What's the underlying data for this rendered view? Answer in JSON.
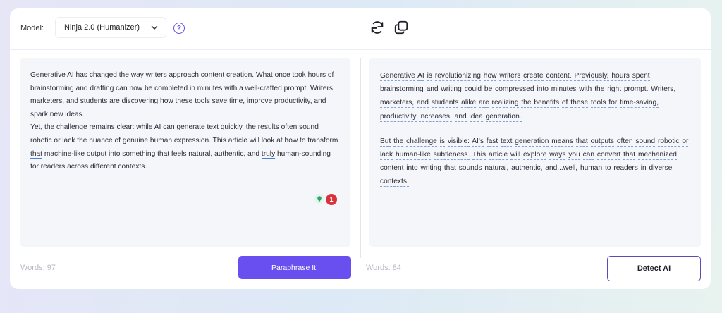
{
  "toolbar": {
    "model_label": "Model:",
    "model_value": "Ninja 2.0 (Humanizer)",
    "help_icon": "question-circle-icon",
    "regenerate_icon": "refresh-icon",
    "copy_icon": "copy-icon"
  },
  "input": {
    "paragraph1": {
      "t1": "Generative AI has changed the way writers approach content creation. What once took hours of brainstorming and drafting can now be completed in minutes with a well-crafted prompt. Writers, marketers, and students are discovering how these tools save time, improve productivity, and spark new ideas."
    },
    "paragraph2": {
      "t1": "Yet, the challenge remains clear: while AI can generate text quickly, the results often sound robotic or lack the nuance of genuine human expression. This article will ",
      "u1": "look at",
      "t2": " how to transform ",
      "u2": "that",
      "t3": " machine-like output into something that feels natural, authentic, and ",
      "u3": "truly",
      "t4": " human-sounding for readers across ",
      "u4": "different",
      "t5": " contexts."
    },
    "suggestion_count": "1",
    "words": "Words: 97"
  },
  "output": {
    "paragraph1": [
      "Generative",
      "AI",
      "is",
      "revolutionizing",
      "how",
      "writers",
      "create",
      "content.",
      "Previously,",
      "hours",
      "spent",
      "brainstorming",
      "and",
      "writing",
      "could",
      "be",
      "compressed",
      "into",
      "minutes",
      "with",
      "the",
      "right",
      "prompt.",
      "Writers,",
      "marketers,",
      "and",
      "students",
      "alike",
      "are",
      "realizing",
      "the",
      "benefits",
      "of",
      "these",
      "tools",
      "for",
      "time-saving,",
      "productivity",
      "increases,",
      "and",
      "idea",
      "generation."
    ],
    "paragraph2": [
      "But",
      "the",
      "challenge",
      "is",
      "visible:",
      "AI's",
      "fast",
      "text",
      "generation",
      "means",
      "that",
      "outputs",
      "often",
      "sound",
      "robotic",
      "or",
      "lack",
      "human-like",
      "subtleness.",
      "This",
      "article",
      "will",
      "explore",
      "ways",
      "you",
      "can",
      "convert",
      "that",
      "mechanized",
      "content",
      "into",
      "writing",
      "that",
      "sounds",
      "natural,",
      "authentic,",
      "and...well,",
      "human",
      "to",
      "readers",
      "in",
      "diverse",
      "contexts."
    ],
    "words": "Words: 84"
  },
  "actions": {
    "paraphrase_label": "Paraphrase It!",
    "detect_label": "Detect AI"
  },
  "colors": {
    "accent": "#6a4ff0",
    "error_badge": "#d9323a",
    "suggestion_badge": "#2ea36b"
  }
}
